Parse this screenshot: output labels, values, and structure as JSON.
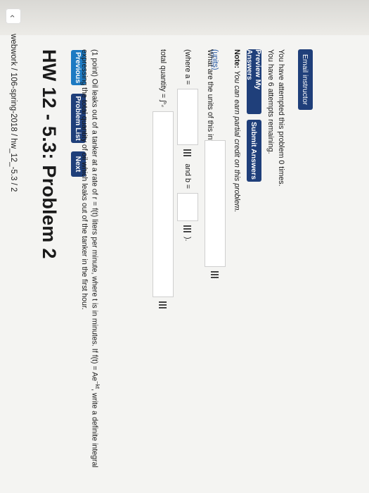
{
  "breadcrumb": {
    "back_icon": "chevron-left-icon",
    "path": "webwork / 106-spring-2018 / hw_12_-5.3 / 2"
  },
  "page_title": "HW 12 - 5.3: Problem 2",
  "nav": {
    "previous": "Previous",
    "problem_list": "Problem List",
    "next": "Next"
  },
  "problem": {
    "statement_1": "(1 point) Oil leaks out of a tanker at a rate of r = f(t) liters per minute, where t is in minutes. If f(t) = Ae",
    "statement_exp": "−kt",
    "statement_2": ", write a definite integral",
    "statement_3": "expressing the total quantity of oil which leaks out of the tanker in the first hour.",
    "total_quantity_label": "total quantity = ∫",
    "integral_limits": "ᵇₐ",
    "where_a_label": "(where a =",
    "and_b_label": "and b =",
    "close_paren": ").",
    "units_question": "What are the units of this integral?",
    "units_link": "(units)"
  },
  "note": {
    "label": "Note:",
    "text": "You can earn partial credit on this problem."
  },
  "actions": {
    "preview": "Preview My Answers",
    "submit": "Submit Answers"
  },
  "status": {
    "attempted": "You have attempted this problem 0 times.",
    "remaining": "You have 6 attempts remaining."
  },
  "email_button": "Email instructor"
}
